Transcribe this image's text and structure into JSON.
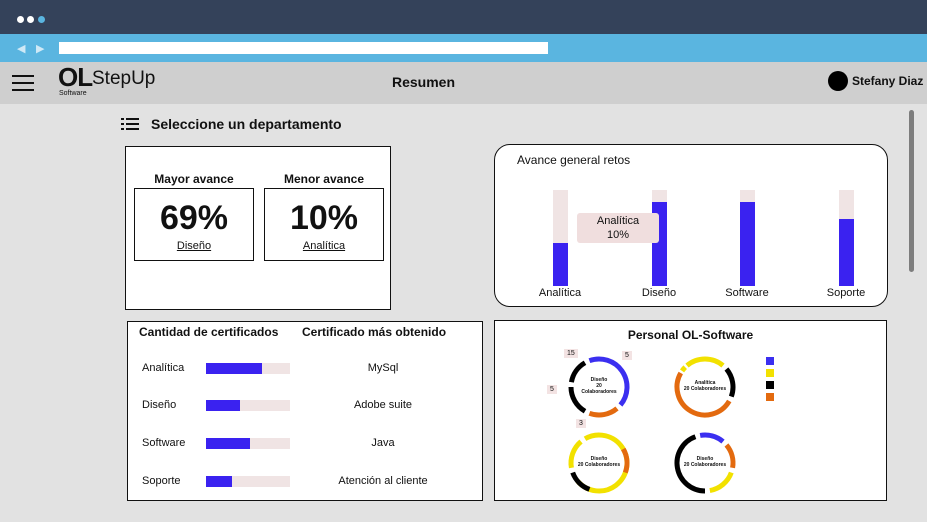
{
  "header": {
    "logo_mark": "OL",
    "logo_sub": "Software",
    "app_name": "StepUp",
    "page_title": "Resumen",
    "user_name": "Stefany Diaz"
  },
  "department_selector": {
    "label": "Seleccione un departamento"
  },
  "progress_card": {
    "highest": {
      "title": "Mayor avance",
      "value": "69%",
      "department": "Diseño"
    },
    "lowest": {
      "title": "Menor avance",
      "value": "10%",
      "department": "Analítica"
    }
  },
  "retos_card": {
    "title": "Avance general retos",
    "tooltip": {
      "label": "Analítica",
      "value": "10%"
    }
  },
  "chart_data": {
    "type": "bar",
    "title": "Avance general retos",
    "categories": [
      "Analítica",
      "Diseño",
      "Software",
      "Soporte"
    ],
    "values": [
      45,
      88,
      88,
      70
    ],
    "ylim": [
      0,
      100
    ],
    "bar_color": "#3a22f0",
    "track_color": "#f0e4e4"
  },
  "certificates_card": {
    "col_count_header": "Cantidad de certificados",
    "col_top_header": "Certificado más obtenido",
    "rows": [
      {
        "department": "Analítica",
        "fraction": 0.67,
        "top_certificate": "MySql"
      },
      {
        "department": "Diseño",
        "fraction": 0.4,
        "top_certificate": "Adobe suite"
      },
      {
        "department": "Software",
        "fraction": 0.52,
        "top_certificate": "Java"
      },
      {
        "department": "Soporte",
        "fraction": 0.31,
        "top_certificate": "Atención al cliente"
      }
    ]
  },
  "staff_card": {
    "title": "Personal OL-Software",
    "donuts": [
      {
        "line1": "Diseño",
        "line2": "20",
        "line3": "Colaboradores"
      },
      {
        "line1": "Analítica",
        "line2": "20 Colaboradores",
        "line3": ""
      },
      {
        "line1": "Diseño",
        "line2": "20 Colaboradores",
        "line3": ""
      },
      {
        "line1": "Diseño",
        "line2": "20 Colaboradores",
        "line3": ""
      }
    ],
    "callouts": [
      "15",
      "5",
      "5",
      "3"
    ],
    "legend_colors": [
      "#3b2ff0",
      "#f2e100",
      "#000000",
      "#e36a0f"
    ]
  },
  "colors": {
    "accent": "#3a22f0",
    "titlebar": "#34425a",
    "urlbar": "#5ab5e0"
  }
}
